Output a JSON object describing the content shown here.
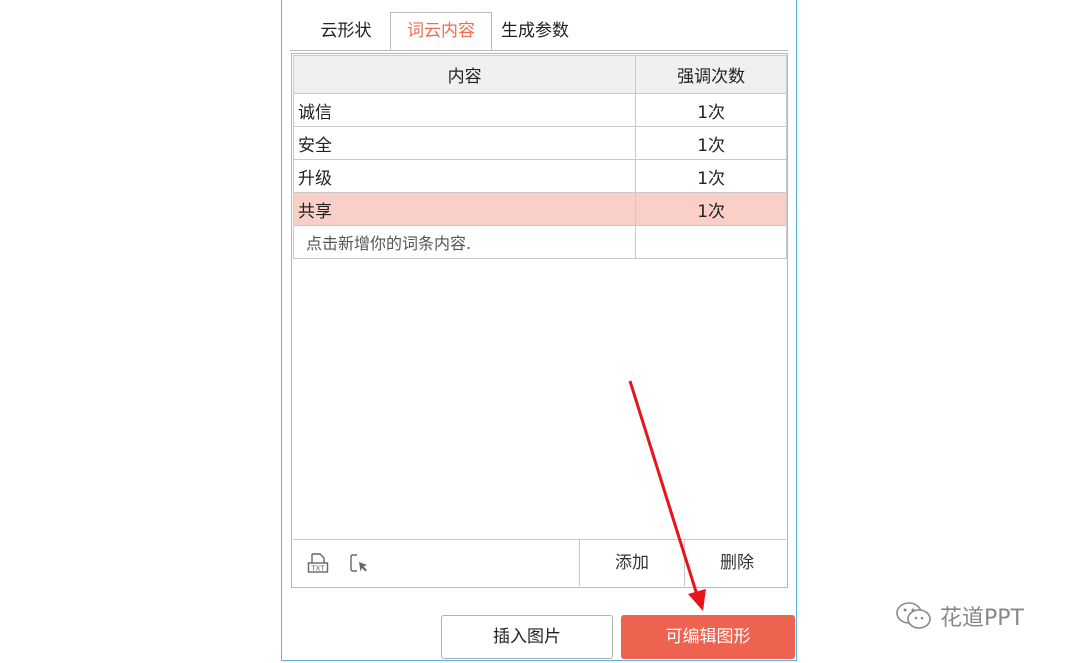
{
  "tabs": [
    {
      "label": "云形状"
    },
    {
      "label": "词云内容"
    },
    {
      "label": "生成参数"
    }
  ],
  "table": {
    "headers": [
      "内容",
      "强调次数"
    ],
    "rows": [
      {
        "word": "诚信",
        "count": "1次"
      },
      {
        "word": "安全",
        "count": "1次"
      },
      {
        "word": "升级",
        "count": "1次"
      },
      {
        "word": "共享",
        "count": "1次"
      }
    ],
    "placeholder": "点击新增你的词条内容."
  },
  "bottombar": {
    "add_label": "添加",
    "delete_label": "删除"
  },
  "actions": {
    "insert_label": "插入图片",
    "edit_label": "可编辑图形"
  },
  "watermark": {
    "text": "花道PPT"
  },
  "colors": {
    "accent": "#ee6250",
    "active_tab": "#ef6b4f",
    "selected_row": "#f9cfc7",
    "panel_border": "#59b3e6",
    "annotation_arrow": "#e8141c"
  }
}
